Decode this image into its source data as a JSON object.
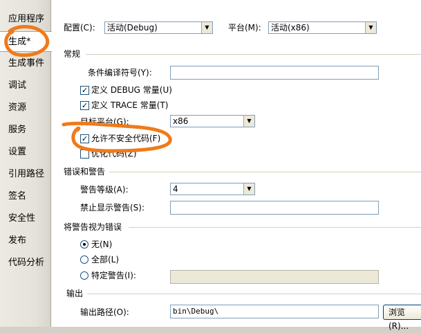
{
  "sidebar": {
    "items": [
      {
        "label": "应用程序"
      },
      {
        "label": "生成*"
      },
      {
        "label": "生成事件"
      },
      {
        "label": "调试"
      },
      {
        "label": "资源"
      },
      {
        "label": "服务"
      },
      {
        "label": "设置"
      },
      {
        "label": "引用路径"
      },
      {
        "label": "签名"
      },
      {
        "label": "安全性"
      },
      {
        "label": "发布"
      },
      {
        "label": "代码分析"
      }
    ],
    "active_index": 1
  },
  "top": {
    "config_label": "配置(C):",
    "config_value": "活动(Debug)",
    "platform_label": "平台(M):",
    "platform_value": "活动(x86)"
  },
  "general": {
    "title": "常规",
    "symbols_label": "条件编译符号(Y):",
    "symbols_value": "",
    "debug_const_label": "定义 DEBUG 常量(U)",
    "debug_const_checked": true,
    "trace_const_label": "定义 TRACE 常量(T)",
    "trace_const_checked": true,
    "target_label": "目标平台(G):",
    "target_value": "x86",
    "unsafe_label": "允许不安全代码(F)",
    "unsafe_checked": true,
    "optimize_label": "优化代码(Z)",
    "optimize_checked": false
  },
  "errors": {
    "title": "错误和警告",
    "warning_level_label": "警告等级(A):",
    "warning_level_value": "4",
    "suppress_label": "禁止显示警告(S):",
    "suppress_value": ""
  },
  "treat_warnings": {
    "title": "将警告视为错误",
    "none_label": "无(N)",
    "all_label": "全部(L)",
    "specific_label": "特定警告(I):",
    "selected": "none",
    "specific_value": ""
  },
  "output": {
    "title": "输出",
    "path_label": "输出路径(O):",
    "path_value": "bin\\Debug\\",
    "browse_label": "浏览(R)..."
  },
  "annotation_color": "#f07a1a"
}
